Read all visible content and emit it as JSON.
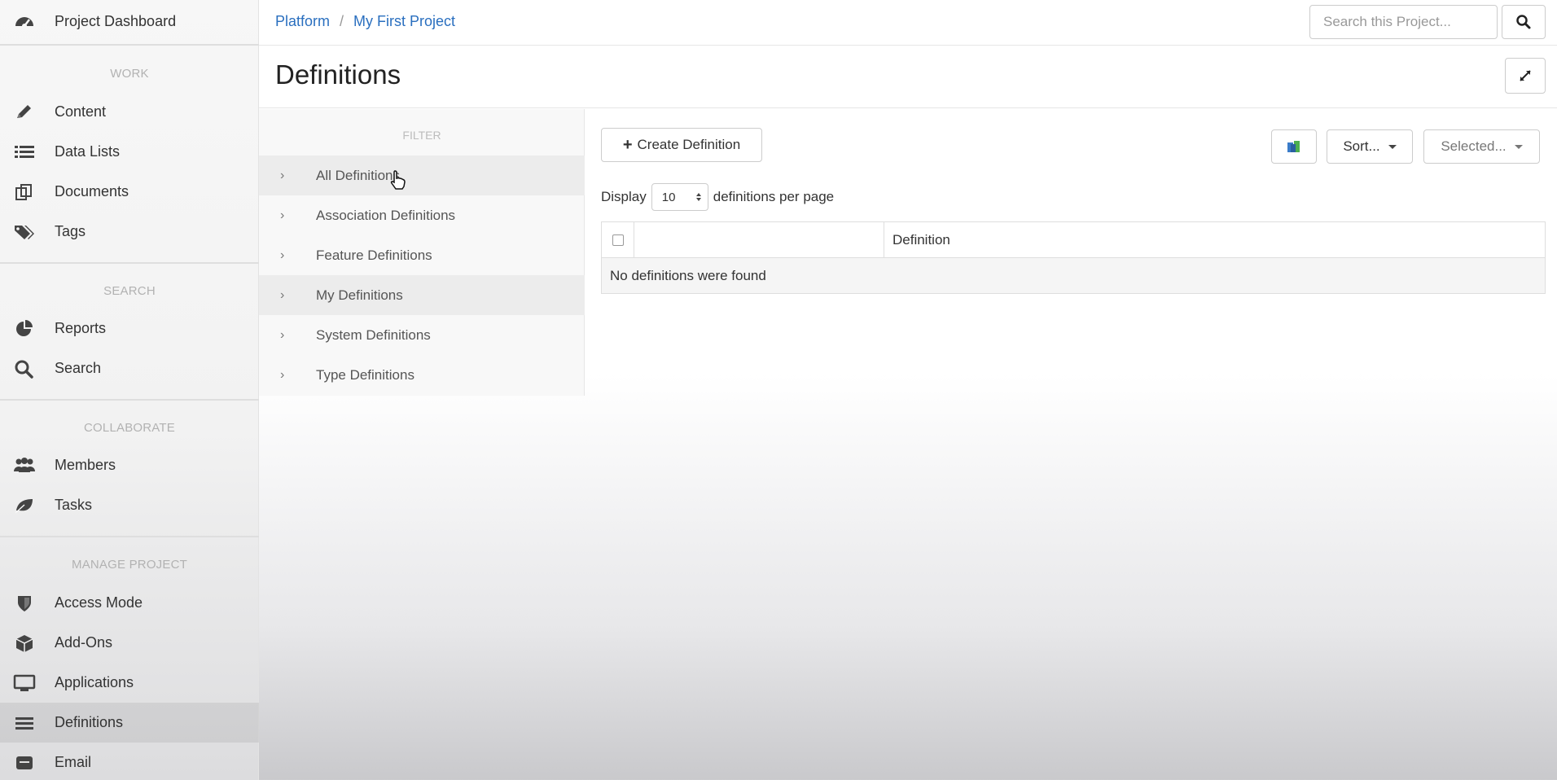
{
  "sidebar": {
    "top": {
      "label": "Project Dashboard",
      "icon": "dashboard-icon"
    },
    "sections": {
      "work": "WORK",
      "search": "SEARCH",
      "collaborate": "COLLABORATE",
      "manage": "MANAGE PROJECT"
    },
    "items": {
      "content": "Content",
      "data_lists": "Data Lists",
      "documents": "Documents",
      "tags": "Tags",
      "reports": "Reports",
      "search": "Search",
      "members": "Members",
      "tasks": "Tasks",
      "access_mode": "Access Mode",
      "add_ons": "Add-Ons",
      "applications": "Applications",
      "definitions": "Definitions",
      "email": "Email"
    },
    "active": "Definitions"
  },
  "breadcrumb": {
    "root": "Platform",
    "sep": "/",
    "project": "My First Project"
  },
  "search": {
    "placeholder": "Search this Project..."
  },
  "page": {
    "title": "Definitions"
  },
  "filter": {
    "heading": "FILTER",
    "items": [
      "All Definitions",
      "Association Definitions",
      "Feature Definitions",
      "My Definitions",
      "System Definitions",
      "Type Definitions"
    ]
  },
  "toolbar": {
    "create_label": "Create Definition",
    "sort_label": "Sort...",
    "selected_label": "Selected..."
  },
  "display": {
    "prefix": "Display",
    "value": "10",
    "suffix": "definitions per page"
  },
  "table": {
    "columns": [
      "",
      "",
      "Definition"
    ],
    "empty_message": "No definitions were found"
  },
  "colors": {
    "link": "#2a6fbf",
    "active_item": "#e8e8e8"
  }
}
